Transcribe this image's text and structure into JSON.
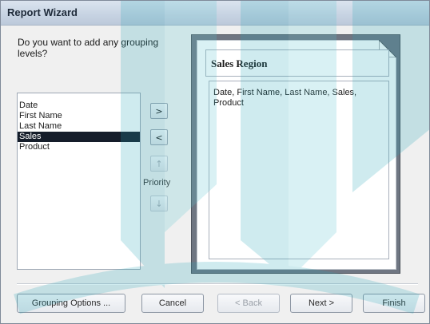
{
  "window": {
    "title": "Report Wizard"
  },
  "question": "Do you want to add any grouping levels?",
  "field_list": {
    "items": [
      {
        "label": "Date",
        "selected": false
      },
      {
        "label": "First Name",
        "selected": false
      },
      {
        "label": "Last Name",
        "selected": false
      },
      {
        "label": "Sales",
        "selected": true
      },
      {
        "label": "Product",
        "selected": false
      }
    ]
  },
  "level_buttons": {
    "add": ">",
    "remove": "<",
    "priority_up": "↑",
    "priority_down": "↓",
    "priority_label": "Priority"
  },
  "preview": {
    "group_label": "Sales Region",
    "detail_text": "Date, First Name, Last Name, Sales, Product"
  },
  "footer": {
    "grouping_options": "Grouping Options ...",
    "cancel": "Cancel",
    "back": "< Back",
    "next": "Next >",
    "finish": "Finish"
  },
  "colors": {
    "selection": "#151d2a",
    "watermark": "#2aa7b8"
  }
}
